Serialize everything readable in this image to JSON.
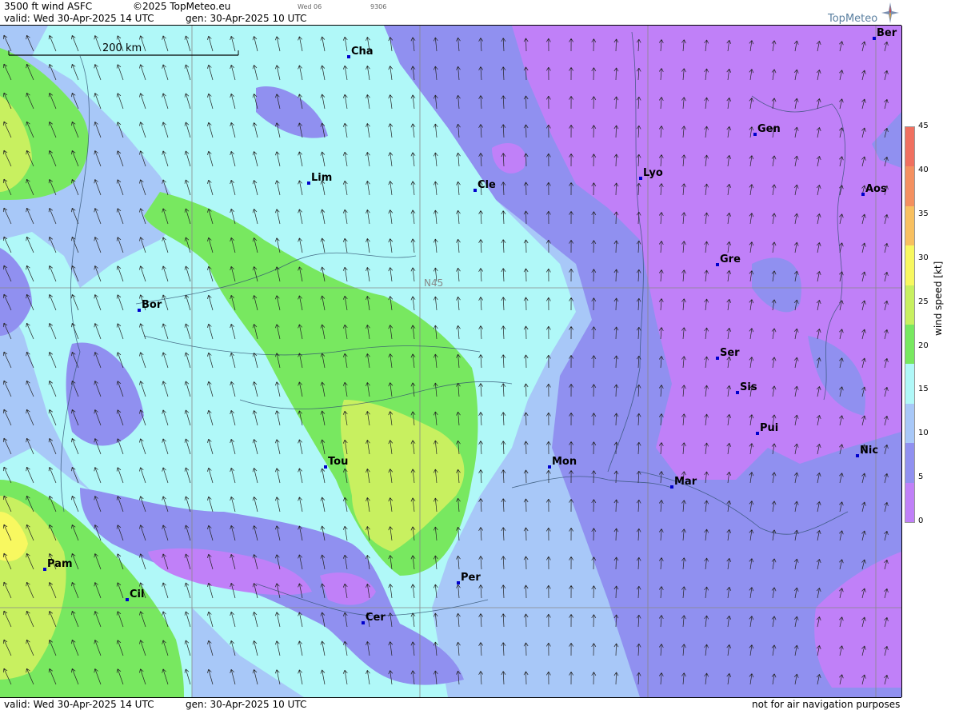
{
  "header": {
    "product": "3500 ft wind ASFC",
    "copyright": "©2025 TopMeteo.eu",
    "run_tag": "Wed 06",
    "code_tag": "9306",
    "valid": "valid:  Wed  30-Apr-2025  14 UTC",
    "gen": "gen: 30-Apr-2025 10 UTC",
    "brand": "TopMeteo"
  },
  "footer": {
    "valid": "valid:  Wed  30-Apr-2025  14 UTC",
    "gen": "gen: 30-Apr-2025 10 UTC",
    "disclaimer": "not for air navigation purposes"
  },
  "map": {
    "scale_label": "200 km",
    "latitude_label": "N45",
    "cities": [
      "Cha",
      "Lim",
      "Cle",
      "Lyo",
      "Gen",
      "Ber",
      "Aos",
      "Gre",
      "Bor",
      "Ser",
      "Sis",
      "Pui",
      "Nic",
      "Tou",
      "Mon",
      "Mar",
      "Pam",
      "Cil",
      "Per",
      "Cer"
    ]
  },
  "legend": {
    "unit": "wind  speed  [kt]",
    "ticks": [
      "45",
      "40",
      "35",
      "30",
      "25",
      "20",
      "15",
      "10",
      "5",
      "0"
    ],
    "colors": [
      "#f07060",
      "#f49060",
      "#f8c060",
      "#f8f860",
      "#c8f060",
      "#78e860",
      "#b0f8f8",
      "#a8c8f8",
      "#9090f0",
      "#c080f8"
    ]
  }
}
